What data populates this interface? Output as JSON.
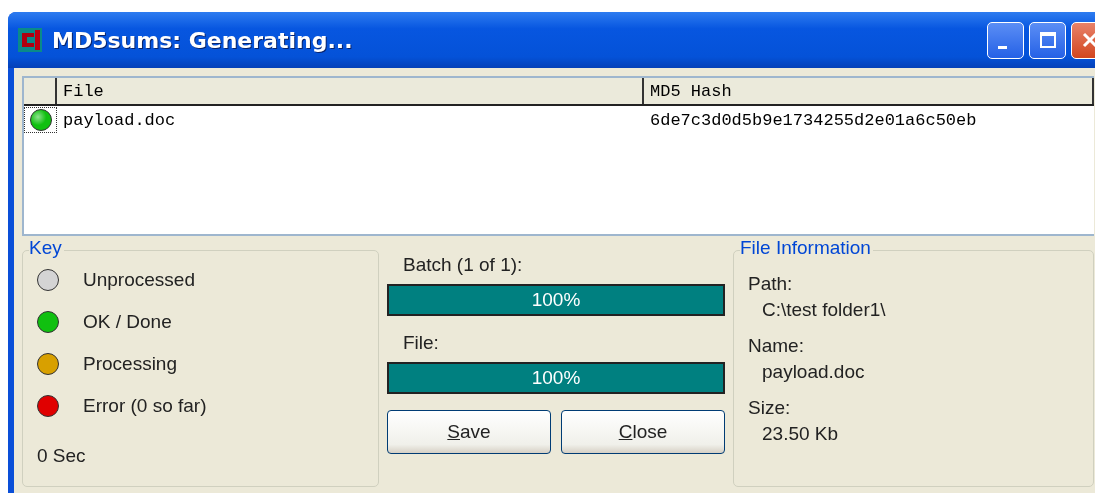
{
  "window": {
    "title": "MD5sums: Generating..."
  },
  "table": {
    "columns": [
      "File",
      "MD5 Hash"
    ],
    "rows": [
      {
        "file": "payload.doc",
        "hash": "6de7c3d0d5b9e1734255d2e01a6c50eb",
        "color": "#10c010",
        "selected": true
      }
    ]
  },
  "key": {
    "title": "Key",
    "items": [
      {
        "label": "Unprocessed",
        "color": "#d4d4d4"
      },
      {
        "label": "OK / Done",
        "color": "#10c010"
      },
      {
        "label": "Processing",
        "color": "#d8a000"
      },
      {
        "label": "Error (0 so far)",
        "color": "#e00000"
      }
    ],
    "elapsed": "0 Sec"
  },
  "progress": [
    {
      "label": "Batch (1 of 1):",
      "level": 1,
      "reading": "100%"
    },
    {
      "label": "File:",
      "level": 1,
      "reading": "100%"
    }
  ],
  "buttons": [
    "Save",
    "Close"
  ],
  "file_info": {
    "title": "File Information",
    "fields": [
      {
        "label": "Path:",
        "value": "C:\\test folder1\\"
      },
      {
        "label": "Name:",
        "value": "payload.doc"
      },
      {
        "label": "Size:",
        "value": "23.50 Kb"
      }
    ]
  }
}
